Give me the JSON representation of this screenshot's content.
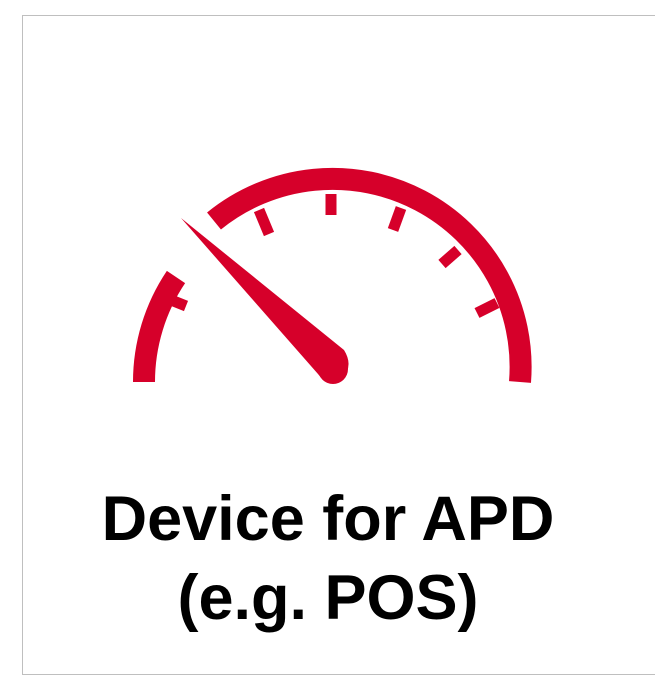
{
  "tile": {
    "icon": "speedometer-icon",
    "accent_color": "#d6002a",
    "text_color": "#000000",
    "border_color": "#bfbfbf",
    "caption_line1": "Device for APD",
    "caption_line2": "(e.g. POS)"
  }
}
